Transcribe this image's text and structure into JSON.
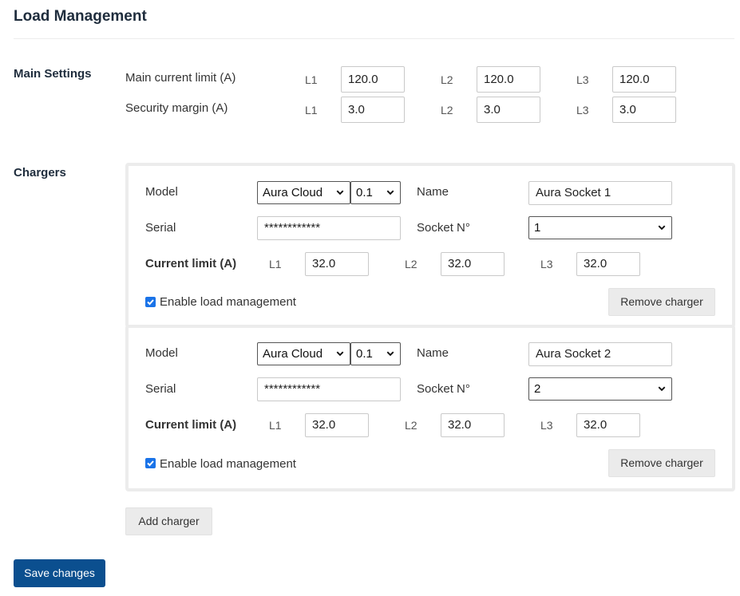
{
  "page": {
    "title": "Load Management"
  },
  "main_settings": {
    "section_label": "Main Settings",
    "main_current": {
      "label": "Main current limit (A)",
      "l1": "120.0",
      "l2": "120.0",
      "l3": "120.0"
    },
    "security_margin": {
      "label": "Security margin (A)",
      "l1": "3.0",
      "l2": "3.0",
      "l3": "3.0"
    },
    "phase_labels": [
      "L1",
      "L2",
      "L3"
    ]
  },
  "chargers": {
    "section_label": "Chargers",
    "field_labels": {
      "model": "Model",
      "name": "Name",
      "serial": "Serial",
      "socket": "Socket N°",
      "current_limit": "Current limit (A)",
      "l1": "L1",
      "l2": "L2",
      "l3": "L3",
      "enable": "Enable load management",
      "remove": "Remove charger"
    },
    "items": [
      {
        "model": "Aura Cloud",
        "version": "0.1",
        "name": "Aura Socket 1",
        "serial": "************",
        "socket": "1",
        "l1": "32.0",
        "l2": "32.0",
        "l3": "32.0",
        "enabled": true
      },
      {
        "model": "Aura Cloud",
        "version": "0.1",
        "name": "Aura Socket 2",
        "serial": "************",
        "socket": "2",
        "l1": "32.0",
        "l2": "32.0",
        "l3": "32.0",
        "enabled": true
      }
    ],
    "add_label": "Add charger"
  },
  "actions": {
    "save_label": "Save changes"
  },
  "colors": {
    "primary": "#0b4f8f",
    "checkbox": "#1a73e8",
    "title": "#1f2d3d"
  }
}
